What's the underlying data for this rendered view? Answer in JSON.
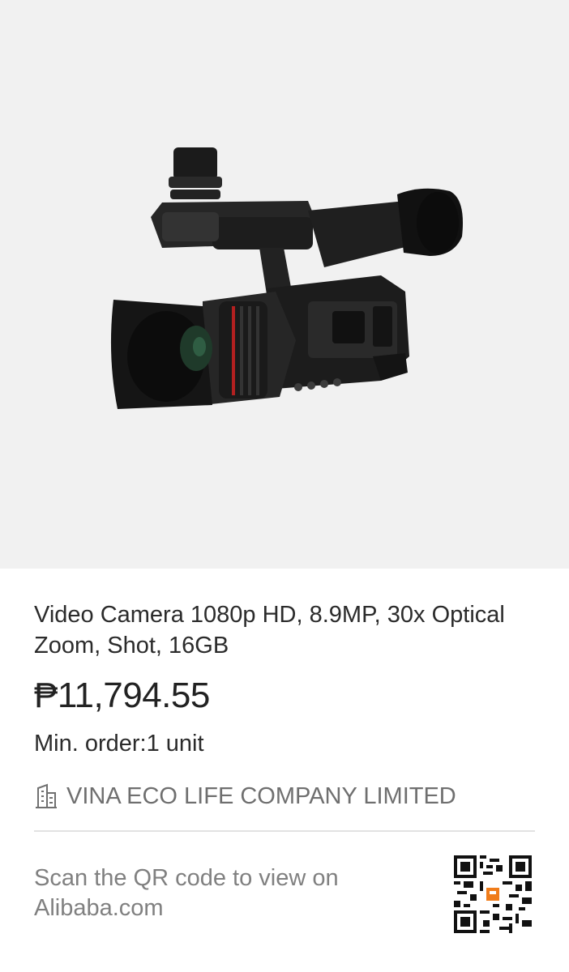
{
  "product": {
    "image_alt": "video-camera-photo",
    "title": "Video Camera 1080p HD, 8.9MP, 30x Optical Zoom, Shot, 16GB",
    "price": "₱11,794.55",
    "min_order": "Min. order:1 unit"
  },
  "supplier": {
    "icon": "building-icon",
    "name": "VINA ECO LIFE COMPANY LIMITED"
  },
  "footer": {
    "scan_text": "Scan the QR code to view on Alibaba.com",
    "qr_icon": "qr-code"
  },
  "colors": {
    "image_bg": "#f1f1f1",
    "text": "#2b2b2b",
    "muted": "#808080",
    "qr_accent": "#f07c1a"
  }
}
